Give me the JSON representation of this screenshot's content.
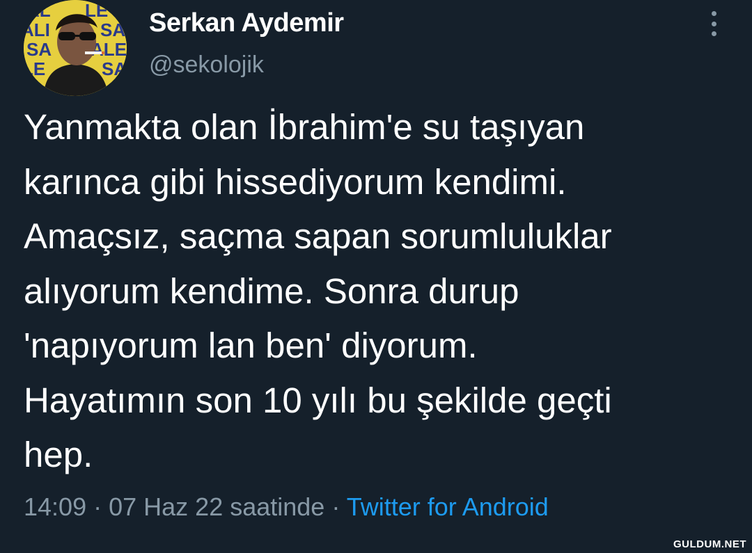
{
  "tweet": {
    "author": {
      "name": "Serkan Aydemir",
      "handle": "@sekolojik",
      "avatar_icon": "profile-photo"
    },
    "more_icon": "more-vertical-icon",
    "text_lines": [
      "Yanmakta olan İbrahim'e su taşıyan",
      "karınca gibi hissediyorum kendimi.",
      "Amaçsız, saçma sapan sorumluluklar",
      "alıyorum kendime. Sonra durup",
      "'napıyorum lan ben' diyorum.",
      "Hayatımın son 10 yılı bu şekilde geçti",
      "hep."
    ],
    "time": "14:09",
    "separator": "·",
    "date": "07 Haz 22 saatinde",
    "source": "Twitter for Android"
  },
  "watermark": "GULDUM.NET",
  "colors": {
    "background": "#15202b",
    "text": "#ffffff",
    "muted": "#8899a6",
    "link": "#1d9bf0"
  }
}
